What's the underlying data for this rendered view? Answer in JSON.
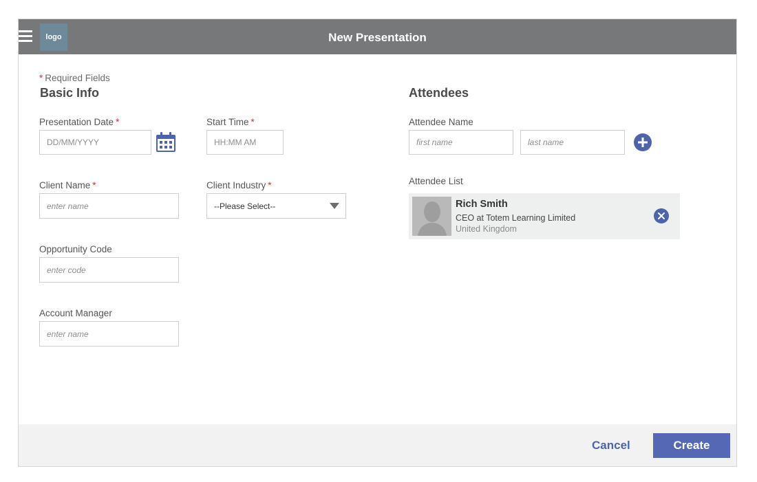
{
  "header": {
    "title": "New Presentation",
    "logo_text": "logo",
    "menu_icon": "hamburger-menu-icon"
  },
  "form": {
    "required_note": "Required Fields",
    "required_marker": "*",
    "basic_info": {
      "title": "Basic Info",
      "presentation_date": {
        "label": "Presentation Date",
        "placeholder": "DD/MM/YYYY",
        "value": ""
      },
      "start_time": {
        "label": "Start Time",
        "placeholder": "HH:MM AM",
        "value": ""
      },
      "client_name": {
        "label": "Client Name",
        "placeholder": "enter name",
        "value": ""
      },
      "client_industry": {
        "label": "Client Industry",
        "selected": "--Please Select--"
      },
      "opportunity_code": {
        "label": "Opportunity Code",
        "placeholder": "enter code",
        "value": ""
      },
      "account_manager": {
        "label": "Account Manager",
        "placeholder": "enter name",
        "value": ""
      }
    },
    "attendees": {
      "title": "Attendees",
      "name_label": "Attendee Name",
      "first_name_placeholder": "first name",
      "last_name_placeholder": "last name",
      "list_label": "Attendee List",
      "list": [
        {
          "name": "Rich Smith",
          "role": "CEO at Totem Learning Limited",
          "location": "United Kingdom"
        }
      ]
    }
  },
  "footer": {
    "cancel_label": "Cancel",
    "create_label": "Create"
  },
  "colors": {
    "header_bg": "#76787a",
    "accent": "#4d63aa",
    "required": "#c0392b"
  }
}
